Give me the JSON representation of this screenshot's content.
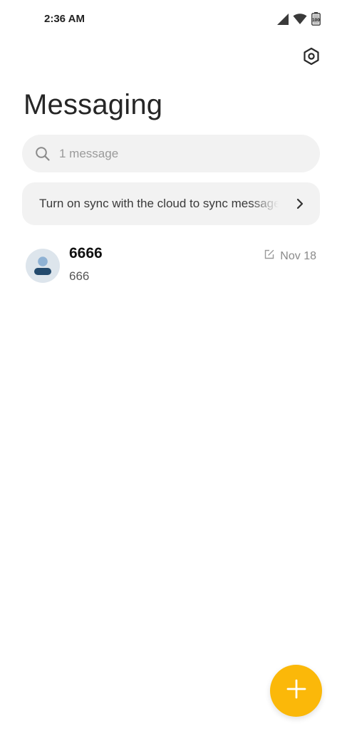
{
  "status_bar": {
    "time": "2:36 AM",
    "battery_level": "100",
    "icons": [
      "cellular-signal-icon",
      "wifi-icon",
      "battery-icon"
    ]
  },
  "header": {
    "title": "Messaging",
    "settings_icon": "settings-hexagon-icon"
  },
  "search": {
    "placeholder": "1 message",
    "icon": "search-icon"
  },
  "sync_banner": {
    "text": "Turn on sync with the cloud to sync messages",
    "icon": "chevron-right-icon"
  },
  "conversations": [
    {
      "name": "6666",
      "snippet": "666",
      "date": "Nov 18",
      "status_icon": "draft-edit-icon",
      "avatar_icon": "person-icon"
    }
  ],
  "fab": {
    "icon": "plus-icon",
    "color": "#fbb809"
  },
  "colors": {
    "accent": "#fbb809",
    "surface": "#f2f2f2",
    "avatar_bg": "#dde5ec",
    "avatar_head": "#8fb2d4",
    "avatar_body": "#234a6d"
  }
}
